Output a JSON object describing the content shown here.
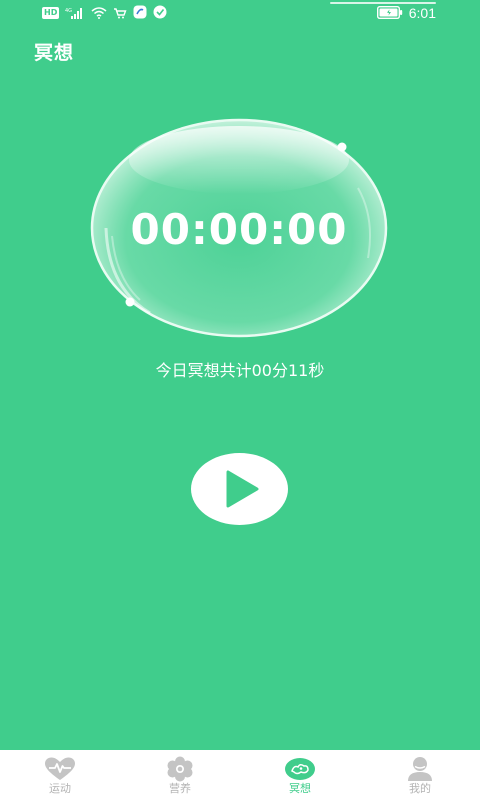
{
  "status_bar": {
    "network_badge": "HD",
    "signal_label": "4G",
    "time": "6:01"
  },
  "header": {
    "title": "冥想"
  },
  "timer": {
    "display": "00:00:00"
  },
  "summary": {
    "text": "今日冥想共计00分11秒"
  },
  "controls": {
    "play_icon": "play-icon"
  },
  "bottom_nav": {
    "items": [
      {
        "label": "运动",
        "icon": "heartbeat-icon",
        "active": false
      },
      {
        "label": "营养",
        "icon": "flower-icon",
        "active": false
      },
      {
        "label": "冥想",
        "icon": "meditation-icon",
        "active": true
      },
      {
        "label": "我的",
        "icon": "person-icon",
        "active": false
      }
    ]
  },
  "colors": {
    "background": "#40cd8c",
    "accent": "#40cd8c",
    "nav_inactive": "#b3b3b3",
    "white": "#ffffff"
  }
}
